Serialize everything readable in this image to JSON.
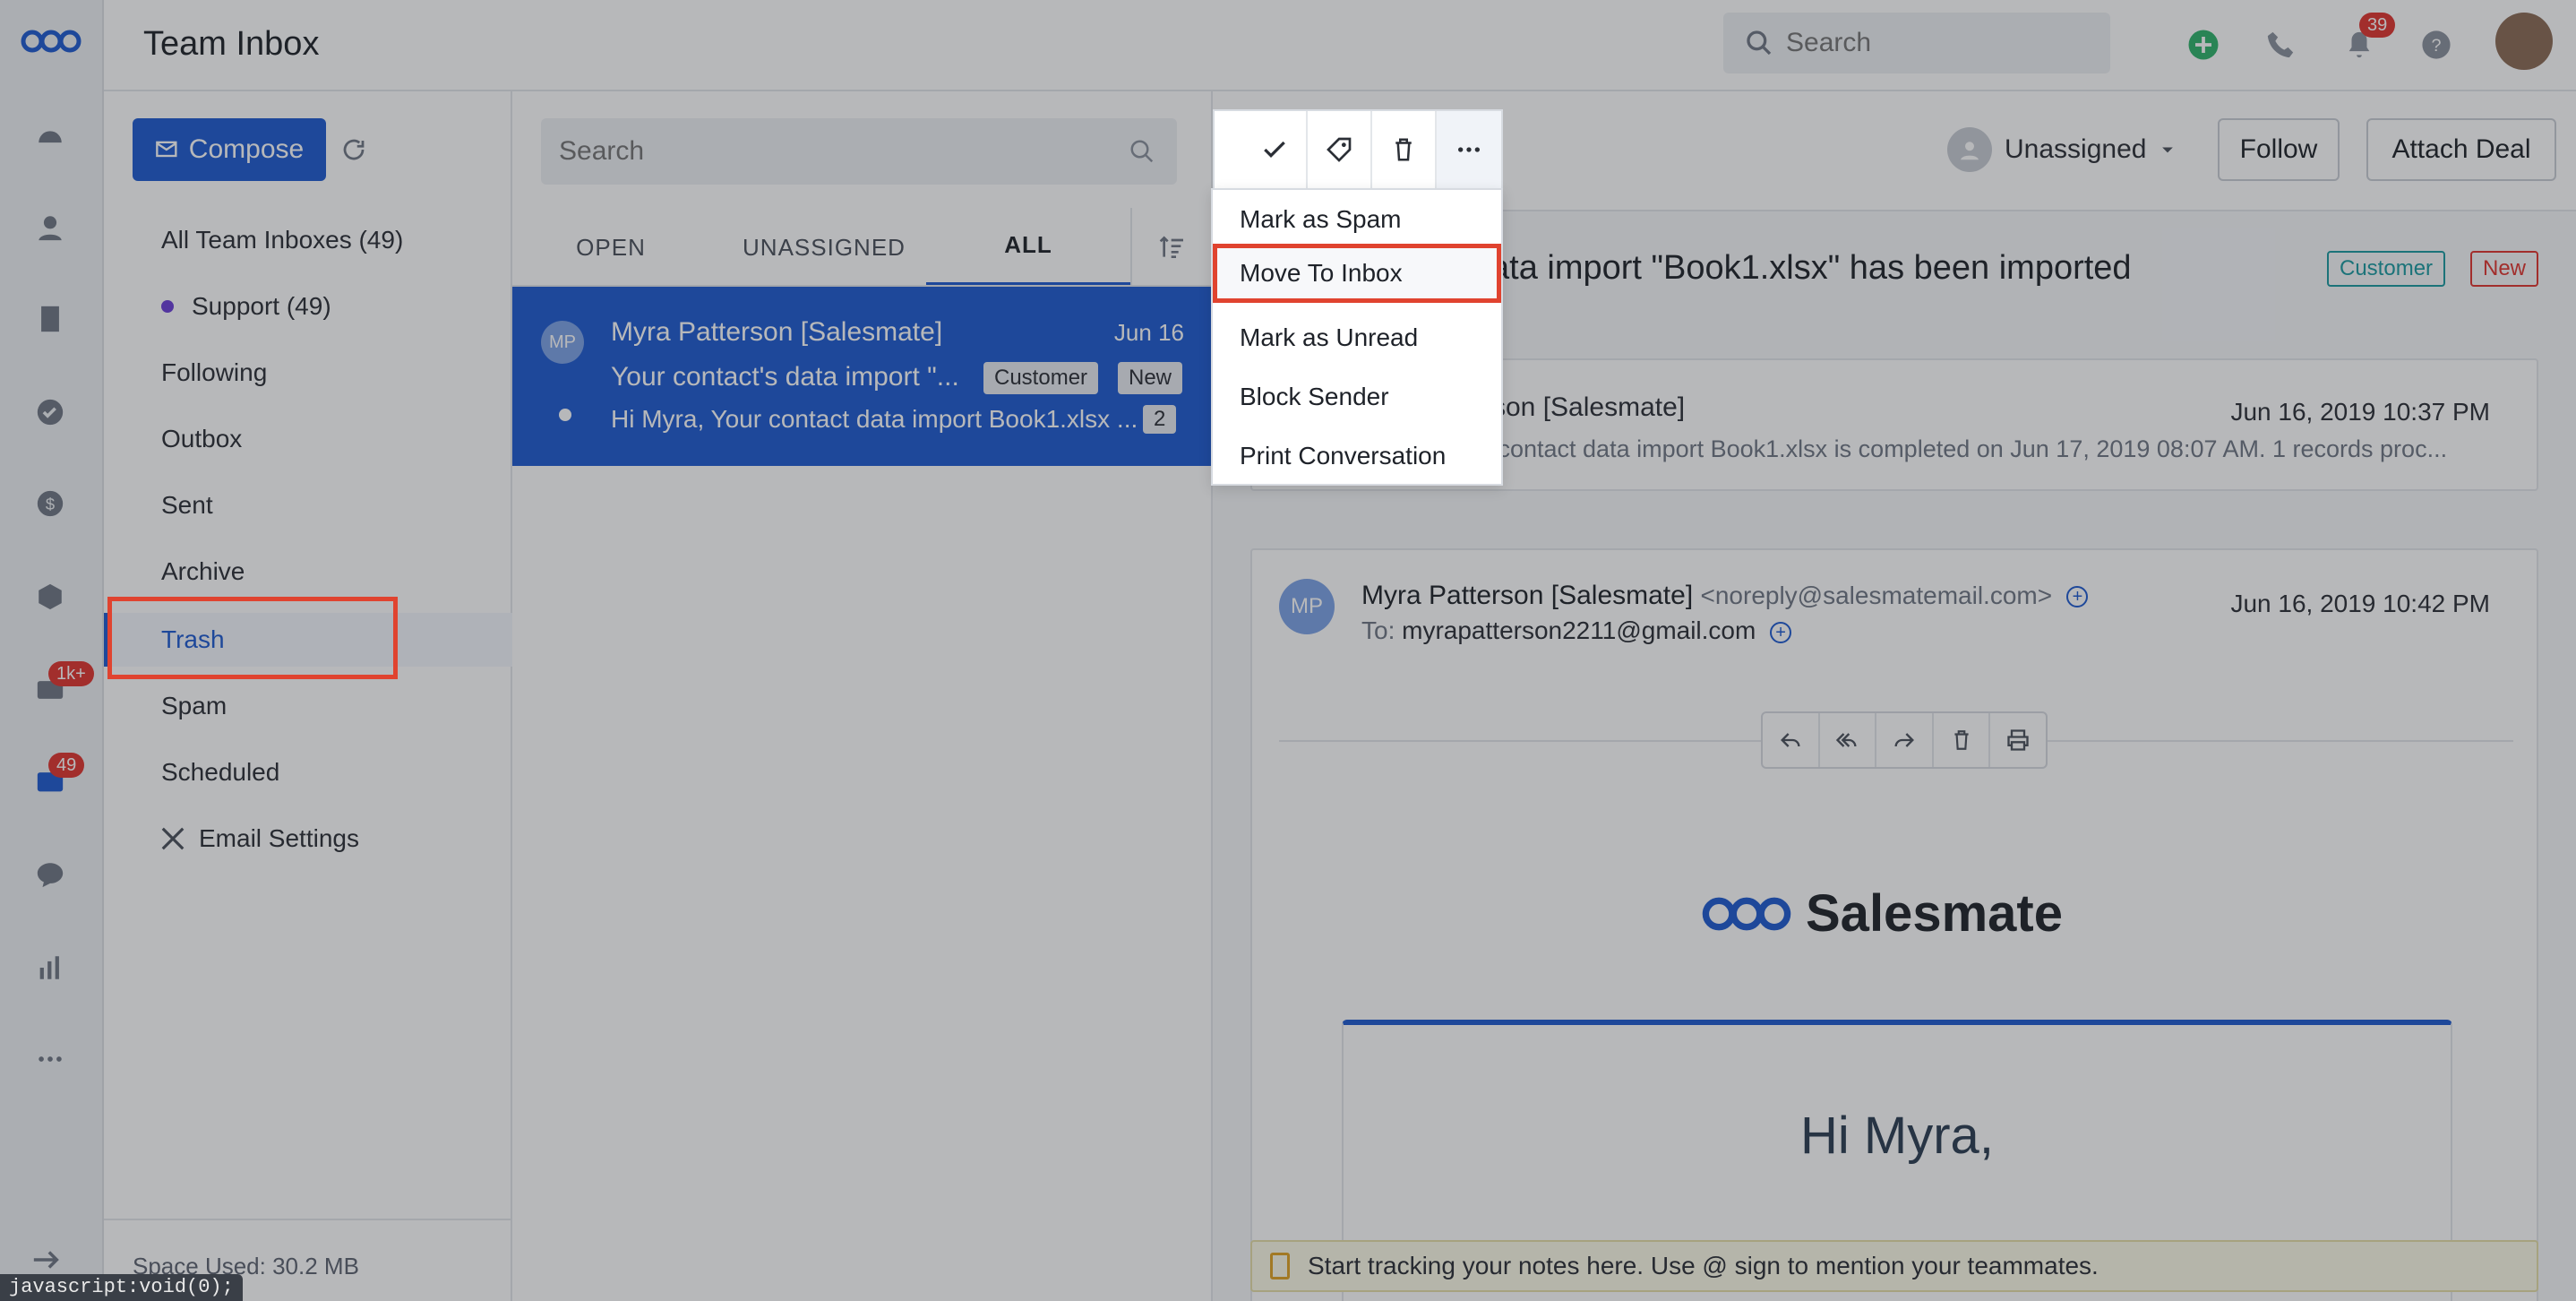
{
  "topbar": {
    "title": "Team Inbox",
    "search_placeholder": "Search",
    "notification_count": "39"
  },
  "rail": {
    "email_badge": "1k+",
    "inbox_badge": "49"
  },
  "folders": {
    "compose_label": "Compose",
    "items": [
      {
        "label": "All Team Inboxes (49)"
      },
      {
        "label": "Support (49)"
      },
      {
        "label": "Following"
      },
      {
        "label": "Outbox"
      },
      {
        "label": "Sent"
      },
      {
        "label": "Archive"
      },
      {
        "label": "Trash"
      },
      {
        "label": "Spam"
      },
      {
        "label": "Scheduled"
      },
      {
        "label": "Email Settings"
      }
    ],
    "space_used": "Space Used: 30.2 MB"
  },
  "list": {
    "search_placeholder": "Search",
    "tabs": [
      {
        "label": "OPEN"
      },
      {
        "label": "UNASSIGNED"
      },
      {
        "label": "ALL"
      }
    ],
    "item": {
      "avatar": "MP",
      "from": "Myra Patterson [Salesmate]",
      "date": "Jun 16",
      "subject": "Your contact's data import \"...",
      "tag_customer": "Customer",
      "tag_new": "New",
      "snippet": "Hi Myra, Your contact data import Book1.xlsx ...",
      "count": "2"
    }
  },
  "detail": {
    "assignee": "Unassigned",
    "follow_label": "Follow",
    "attach_deal_label": "Attach Deal",
    "subject": "ata import \"Book1.xlsx\" has been imported",
    "tag_customer": "Customer",
    "tag_new": "New",
    "msg1": {
      "from": "rson [Salesmate]",
      "date": "Jun 16, 2019 10:37 PM",
      "snippet": "r contact data import Book1.xlsx is completed on Jun 17, 2019 08:07 AM. 1 records proc..."
    },
    "msg2": {
      "avatar": "MP",
      "from": "Myra Patterson [Salesmate]",
      "from_addr": "<noreply@salesmatemail.com>",
      "to_label": "To:",
      "to": "myrapatterson2211@gmail.com",
      "date": "Jun 16, 2019 10:42 PM",
      "brand": "Salesmate",
      "greeting": "Hi Myra,"
    },
    "notes_placeholder": "Start tracking your notes here. Use @ sign to mention your teammates."
  },
  "menu": {
    "items": [
      {
        "label": "Mark as Spam"
      },
      {
        "label": "Move To Inbox"
      },
      {
        "label": "Mark as Unread"
      },
      {
        "label": "Block Sender"
      },
      {
        "label": "Print Conversation"
      }
    ]
  },
  "status_tip": "javascript:void(0);",
  "colors": {
    "accent": "#1e5bd0",
    "highlight": "#e0432f",
    "overlay": "rgba(30,34,41,0.32)"
  }
}
